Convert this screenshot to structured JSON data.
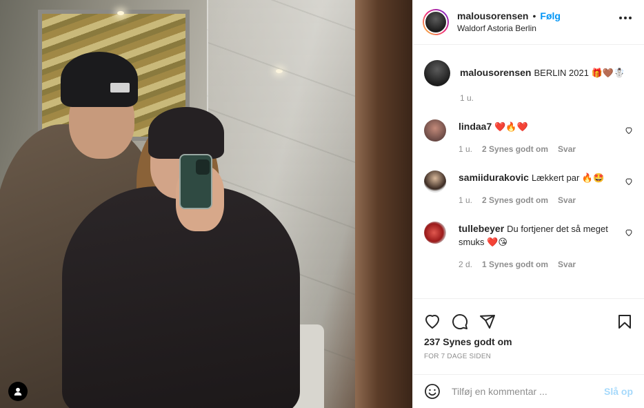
{
  "header": {
    "username": "malousorensen",
    "separator": "•",
    "follow_label": "Følg",
    "location": "Waldorf Astoria Berlin",
    "more_icon": "more-horizontal-icon"
  },
  "caption": {
    "username": "malousorensen",
    "text": "BERLIN 2021 🎁🤎☃️",
    "time": "1 u."
  },
  "comments": [
    {
      "username": "lindaa7",
      "text": "❤️🔥❤️",
      "time": "1 u.",
      "likes": "2 Synes godt om",
      "reply": "Svar"
    },
    {
      "username": "samiidurakovic",
      "text": "Lækkert par 🔥🤩",
      "time": "1 u.",
      "likes": "2 Synes godt om",
      "reply": "Svar"
    },
    {
      "username": "tullebeyer",
      "text": "Du fortjener det så meget smuks ❤️😘",
      "time": "2 d.",
      "likes": "1 Synes godt om",
      "reply": "Svar"
    }
  ],
  "actions": {
    "like_icon": "heart-icon",
    "comment_icon": "comment-icon",
    "share_icon": "paper-plane-icon",
    "save_icon": "bookmark-icon",
    "likes_count": "237 Synes godt om",
    "posted_ago": "FOR 7 DAGE SIDEN"
  },
  "add_comment": {
    "placeholder": "Tilføj en kommentar ...",
    "post_label": "Slå op"
  },
  "colors": {
    "accent": "#0095f6",
    "text": "#262626",
    "muted": "#8e8e8e",
    "border": "#efefef"
  }
}
